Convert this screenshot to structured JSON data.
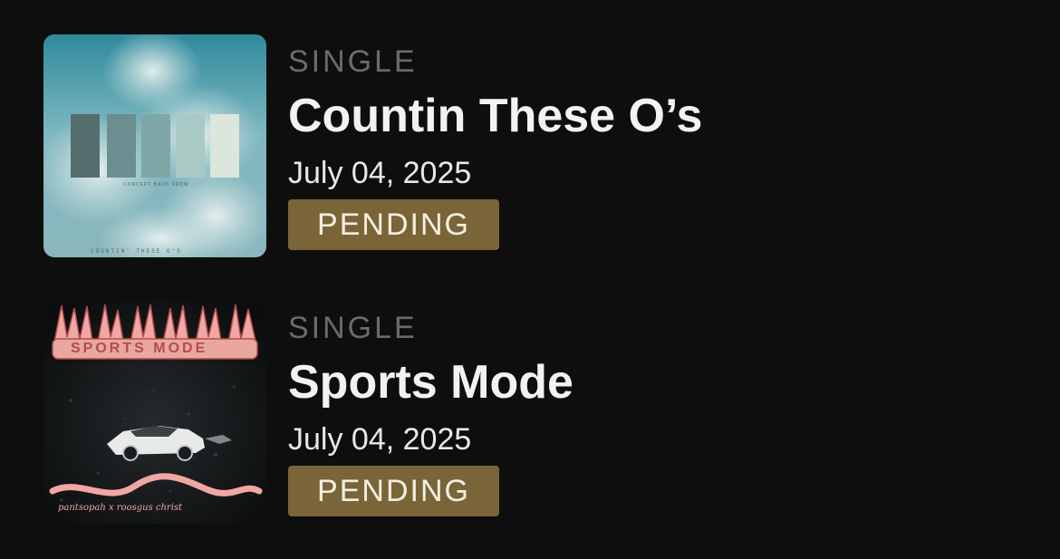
{
  "releases": [
    {
      "type": "SINGLE",
      "title": "Countin These O’s",
      "date": "July 04, 2025",
      "status": "PENDING",
      "cover": {
        "icon": "album-cover-clouds",
        "caption_small": "CONCEPT BACK FROM",
        "caption_bottom": "COUNTIN' THESE O'S"
      }
    },
    {
      "type": "SINGLE",
      "title": "Sports Mode",
      "date": "July 04, 2025",
      "status": "PENDING",
      "cover": {
        "icon": "album-cover-sports-car",
        "caption_top": "SPORTS MODE",
        "caption_bottom": "pantsopah x roosgus christ"
      }
    }
  ],
  "colors": {
    "background": "#0e0e0e",
    "badge": "#7a6538",
    "muted_label": "#6b6b6b",
    "title": "#f2f2f2"
  }
}
